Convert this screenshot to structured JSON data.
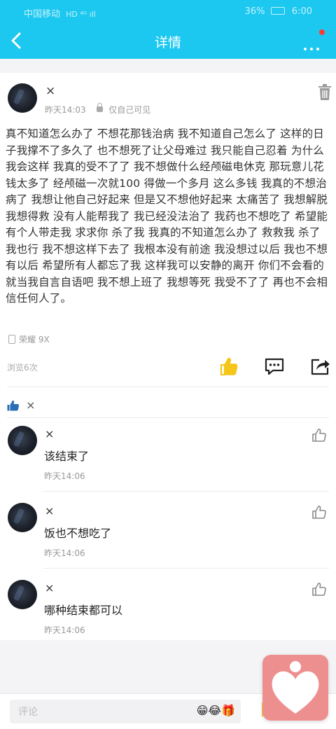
{
  "status_bar": {
    "carrier": "中国移动",
    "indicators": "HD ⁴ᴳ ıll",
    "battery": "36%",
    "time": "6:00"
  },
  "nav": {
    "title": "详情"
  },
  "post": {
    "author": "×",
    "time": "昨天14:03",
    "visibility": "仅自己可见",
    "content": "真不知道怎么办了 不想花那钱治病 我不知道自己怎么了 这样的日子我撑不了多久了 也不想死了让父母难过 我只能自己忍着 为什么我会这样 我真的受不了了 我不想做什么经颅磁电休克 那玩意儿花钱太多了 经颅磁一次就100 得做一个多月 这么多钱 我真的不想治病了 我想让他自己好起来 但是又不想他好起来 太痛苦了 我想解脱 我想得救 没有人能帮我了 我已经没法治了 我药也不想吃了 希望能有个人带走我 求求你 杀了我 我真的不知道怎么办了 救救我 杀了我也行 我不想这样下去了 我根本没有前途 我没想过以后 我也不想有以后 希望所有人都忘了我 这样我可以安静的离开 你们不会看的 就当我自言自语吧 我不想上班了 我想等死 我受不了了 再也不会相信任何人了。",
    "device": "荣耀 9X",
    "views": "浏览6次"
  },
  "likers": {
    "names": "×"
  },
  "comments": [
    {
      "author": "×",
      "text": "该结束了",
      "time": "昨天14:06"
    },
    {
      "author": "×",
      "text": "饭也不想吃了",
      "time": "昨天14:06"
    },
    {
      "author": "×",
      "text": "哪种结束都可以",
      "time": "昨天14:06"
    }
  ],
  "bottom_bar": {
    "comment_placeholder": "评论",
    "emoji_row": "😁😂🎁"
  },
  "colors": {
    "header": "#1cc8f0",
    "like_active": "#f5c518",
    "float_button": "#ee8f8f"
  }
}
